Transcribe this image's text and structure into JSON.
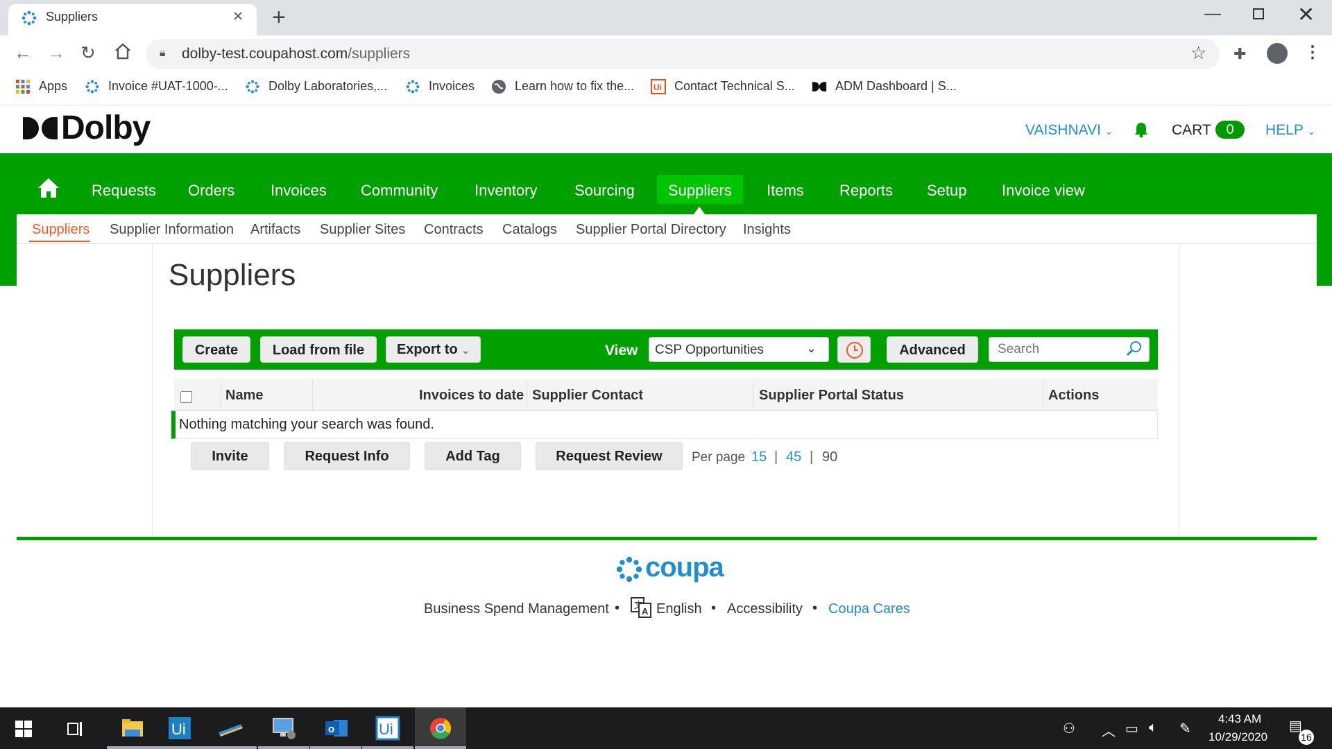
{
  "browser": {
    "tab_title": "Suppliers",
    "url_host": "dolby-test.coupahost.com",
    "url_path": "/suppliers",
    "bookmarks": [
      {
        "label": "Apps"
      },
      {
        "label": "Invoice #UAT-1000-..."
      },
      {
        "label": "Dolby Laboratories,..."
      },
      {
        "label": "Invoices"
      },
      {
        "label": "Learn how to fix the..."
      },
      {
        "label": "Contact Technical S..."
      },
      {
        "label": "ADM Dashboard | S..."
      }
    ]
  },
  "header": {
    "logo": "Dolby",
    "user": "VAISHNAVI",
    "cart_label": "CART",
    "cart_count": "0",
    "help": "HELP"
  },
  "nav": {
    "items": [
      "Requests",
      "Orders",
      "Invoices",
      "Community",
      "Inventory",
      "Sourcing",
      "Suppliers",
      "Items",
      "Reports",
      "Setup",
      "Invoice view"
    ],
    "active": "Suppliers"
  },
  "subnav": {
    "items": [
      "Suppliers",
      "Supplier Information",
      "Artifacts",
      "Supplier Sites",
      "Contracts",
      "Catalogs",
      "Supplier Portal Directory",
      "Insights"
    ],
    "active": "Suppliers"
  },
  "page": {
    "title": "Suppliers"
  },
  "toolbar": {
    "create": "Create",
    "load": "Load from file",
    "export": "Export to",
    "view_label": "View",
    "view_value": "CSP Opportunities",
    "advanced": "Advanced",
    "search_placeholder": "Search"
  },
  "table": {
    "columns": [
      "Name",
      "Invoices to date",
      "Supplier Contact",
      "Supplier Portal Status",
      "Actions"
    ],
    "empty_message": "Nothing matching your search was found."
  },
  "bulk_actions": {
    "invite": "Invite",
    "request_info": "Request Info",
    "add_tag": "Add Tag",
    "request_review": "Request Review"
  },
  "pagination": {
    "label": "Per page",
    "options": [
      "15",
      "45",
      "90"
    ],
    "selected": "90"
  },
  "footer": {
    "brand": "coupa",
    "bsm": "Business Spend Management",
    "language": "English",
    "accessibility": "Accessibility",
    "cares": "Coupa Cares"
  },
  "taskbar": {
    "time": "4:43 AM",
    "date": "10/29/2020",
    "notifications": "16"
  },
  "colors": {
    "brand_green": "#00a000",
    "active_green": "#00c400",
    "link_blue": "#1f8fd1",
    "sub_active": "#ef5a28"
  }
}
